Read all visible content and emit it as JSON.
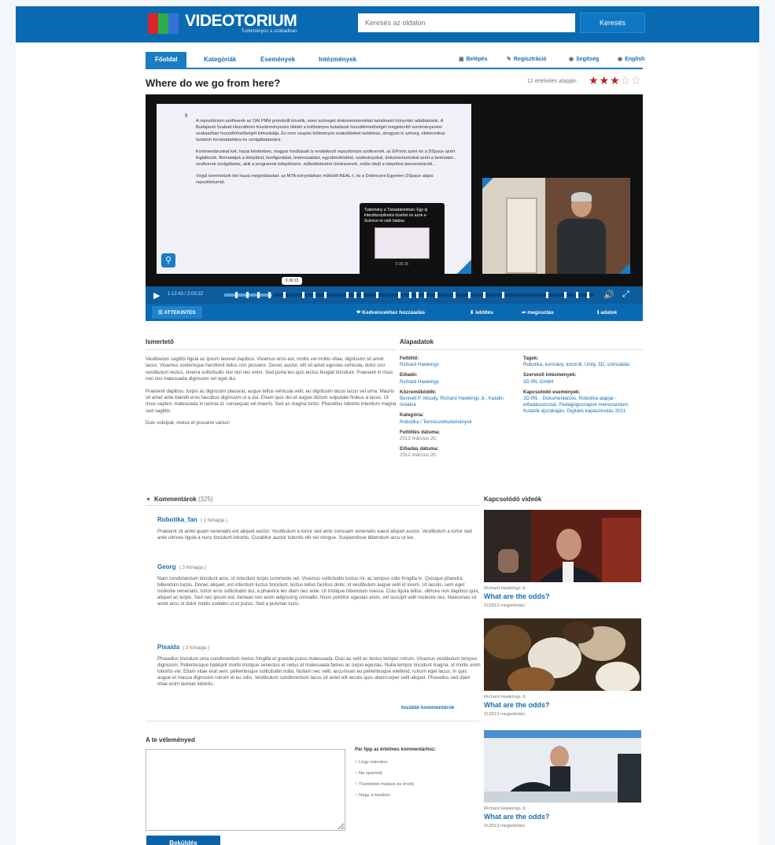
{
  "header": {
    "logo_name": "VIDEOTORIUM",
    "logo_tagline": "Tudományos a szabadban",
    "search_placeholder": "Keresés az oldalon",
    "search_button": "Keresés"
  },
  "nav": {
    "tabs": [
      "Főoldal",
      "Kategóriák",
      "Események",
      "Intézmények"
    ],
    "util": [
      {
        "icon": "lock-icon",
        "label": "Belépés"
      },
      {
        "icon": "pencil-icon",
        "label": "Regisztráció"
      },
      {
        "icon": "help-icon",
        "label": "Segítség"
      },
      {
        "icon": "globe-icon",
        "label": "English"
      }
    ]
  },
  "video": {
    "title": "Where do we go from here?",
    "rating_text": "12 értékelés alapján",
    "stars_filled": 3,
    "stars_total": 5,
    "slide_number": "9",
    "slide_paragraphs": [
      "A repozitórium szoftverek az OAI PMH protokollt követik, ezen szöveget dokumentumokkal tartalmazó könyvtári adatbázisok. A Budapesti Szabad Hozzáférés Kezdeményezés ötletét a kollmányos kutatások hozzáférhetőségét megjelenítő sorsiményezési szakaszban hozzáférhetőségét kimunkálja. Ez nem csupán kollmányos szakcikkeket tartalmaz, ahogyan is szöveg, elektronikus tartalom forrásadatokra és szolgáltatásokra.",
      "Kommentárunkat két, hazai kérdésben, magyar fordításait is rendelkező repozitórium szoftvernél, az EPrints azért és a DSpace azért foglalkozik. Bemutatjuk a telepítést, konfigurálást, testreszabást, együttműködést, szabványokat, dokumentumokat azért a bemutató... szoftverek szolgáltatás, akik a programok telepítésére, működtetésére törekszenek, reális idejű a telepítési demonstrációt...",
      "Végül ismertetünk két hazai megoldásokat: az MTA-könyvtárban működő REAL-t, és a Debreceni Egyetem DSpace alapú repozitóriumát."
    ],
    "tooltip_text": "Tudomány a Társadalomban: Egy új interdiszciplináris kísérlet és azok e-Science-re való hatása",
    "tooltip_time": "0:36:15",
    "hover_time": "0:36:15",
    "time_display": "1:12:43 / 2:03:22",
    "progress": 0.13,
    "chapter_marks": [
      0.03,
      0.06,
      0.09,
      0.12,
      0.16,
      0.21,
      0.24,
      0.27,
      0.33,
      0.35,
      0.37,
      0.41,
      0.47,
      0.5,
      0.52,
      0.54,
      0.57,
      0.62,
      0.66,
      0.7,
      0.75,
      0.87,
      0.92,
      0.95,
      0.98
    ],
    "contents_label": "ATTEKINTES",
    "actions": [
      {
        "icon": "heart-icon",
        "label": "Kedvencekhez hozzáadás"
      },
      {
        "icon": "download-icon",
        "label": "letöltés"
      },
      {
        "icon": "share-icon",
        "label": "megosztás"
      },
      {
        "icon": "info-icon",
        "label": "adatok"
      }
    ]
  },
  "description": {
    "heading": "Ismertető",
    "paragraphs": [
      "Vestibulum sagittis ligula ac ipsum laoreet dapibus. Vivamus eros est, mollis vel mollis vitae, dignissim sit amet lacus. Vivamus scelerisque hendrerit tellus non posuere. Donec auctor, elit sit amet egestas vehicula, dolor orci vestibulum lectus, viverra sollicitudin nisl nisi nec enim. Sed porta leo quis lectus feugiat tincidunt. Praesent in risus nec nisl malesuada dignissim vel eget dui.",
      "Praesent dapibus, turpis ac dignissim placerat, augue tellus vehicula velit, eu dignissim lacus lacus vel urna. Mauris sit amet ante blandit eros faucibus dignissim ut a dui. Etiam quis dui et augue dictum vulputate finibus a lacus. Ut risus sapien, malesuada in lacinia id, consequat vel mauris. Sed ac magna tortor. Phasellus lobortis interdum magna sed sagittis.",
      "Duis volutpat, metus et posuere varius!"
    ]
  },
  "details": {
    "heading": "Alapadatok",
    "left": [
      {
        "label": "Feltöltő:",
        "value": "Richard Hawkings"
      },
      {
        "label": "Előadó:",
        "value": "Richard Hawkings"
      },
      {
        "label": "Közreműködők:",
        "value": "Bennett P. Moody, Richard Hawkings Jr., Katalin Antalné"
      },
      {
        "label": "Kategória:",
        "value": "Robotika / Természettudományok"
      },
      {
        "label": "Feltöltés dátuma:",
        "value": "2012 március 20.",
        "gray": true
      },
      {
        "label": "Előadás dátuma:",
        "value": "2012 március 20.",
        "gray": true
      }
    ],
    "right": [
      {
        "label": "Tagek:",
        "value": "Robotika, kormány, kontroll, Unity, 3D, szimulálás"
      },
      {
        "label": "Szervező intézmények:",
        "value": "3D IRL GmbH"
      },
      {
        "label": "Kapcsolódó események:",
        "value": "3D IRL - Dokumentációs, Robotika alapjai - előadássorozat, Pedagógusnapok memorandum, Kutatók éjszakáján, Digitális kapaszkodás 2021"
      }
    ]
  },
  "comments": {
    "heading": "Kommentárok",
    "count": "(325)",
    "items": [
      {
        "author": "Robotika_fan",
        "when": "( 2 hónapja )",
        "text": "Praesent sit amet quam venenatis est aliquet auctor. Vestibulum a tortor sed ante consuam venenatis eaest aliquet auctor. Vestibulum a tortor sed ante ultrices ligula a nunc tincidunt lobortis. Curabitur auctor lobortis elit vel congue. Suspendisse bibendum arcu ut leo."
      },
      {
        "author": "Georg",
        "when": "( 3 hónapja )",
        "text": "Nam condimentum tincidunt arcu, id interdum turpis commodo vel. Vivamus sollicitudin luctus mi, ac tempus odio fringilla in. Quisque pharetra bibendum turpis. Donec aliquet, est interdum luctus tincidunt, lectus tellus facilisis dolor, id vestibulum augue velit id lorem. Ut iaculis, sem eget molestie venenatis, tortor eros sollicitudin dui, a pharetra leo diam nec ante. Ut tristique bibendum massa. Cras ligula tellus, ultrices non dapibus quis, aliquet ac turpis. Sed nec ipsum est. Aenean nec enim adipiscing convallis. Nunc porttitor egestas enim, vel suscipit velit molestie nec. Maecenas sit amet arcu ut dolor mollis sodales ut et purus. Sed a pulvinar nunc."
      },
      {
        "author": "Pisaida",
        "when": "( 3 hónapja )",
        "text": "Phasellus tincidunt urna condimentum metus fringilla et gravida purus malesuada. Duis ac velit ac lectus tempor rutrum. Vivamus vestibulum tempus dignissim. Pellentesque habitant morbi tristique senectus et netus et malesuada fames ac turpis egestas. Nulla tempor tincidunt magna, ut mollis enim lobortis vel. Etiam vitae erat sem, pellentesque sollicitudin nulla. Nullam nec velit, accumsan eu pellentesque eleifend, rutrum eget lacus. In quis augue et massa dignissim rutrum et eu odio. Vestibulum condimentum lacus sit amet elit iaculis quis ullamcorper velit aliquet. Phasellus sed diam vitae enim laoreet lobortis."
      }
    ],
    "more_link": "további kommentárok"
  },
  "opinion": {
    "heading": "A te véleményed",
    "rules_heading": "Pár tipp az értelmes kommentárhoz:",
    "rules": [
      "Légy releváns",
      "Ne spamelj",
      "Tiszteletet mutass és érvelj",
      "Nagy a bizalom"
    ],
    "submit": "Beküldés"
  },
  "related": {
    "heading": "Kapcsolódó videók",
    "items": [
      {
        "author": "Richard Hawkings Jr.",
        "title": "What are the odds?",
        "views": "312813 megtekintés"
      },
      {
        "author": "Richard Hawkings Jr.",
        "title": "What are the odds?",
        "views": "312813 megtekintés"
      },
      {
        "author": "Richard Hawkings Jr.",
        "title": "What are the odds?",
        "views": "312813 megtekintés"
      }
    ]
  },
  "colors": {
    "brand": "#0a6ab1",
    "accent": "#1a7cc2",
    "stars": "#c41e1e"
  }
}
